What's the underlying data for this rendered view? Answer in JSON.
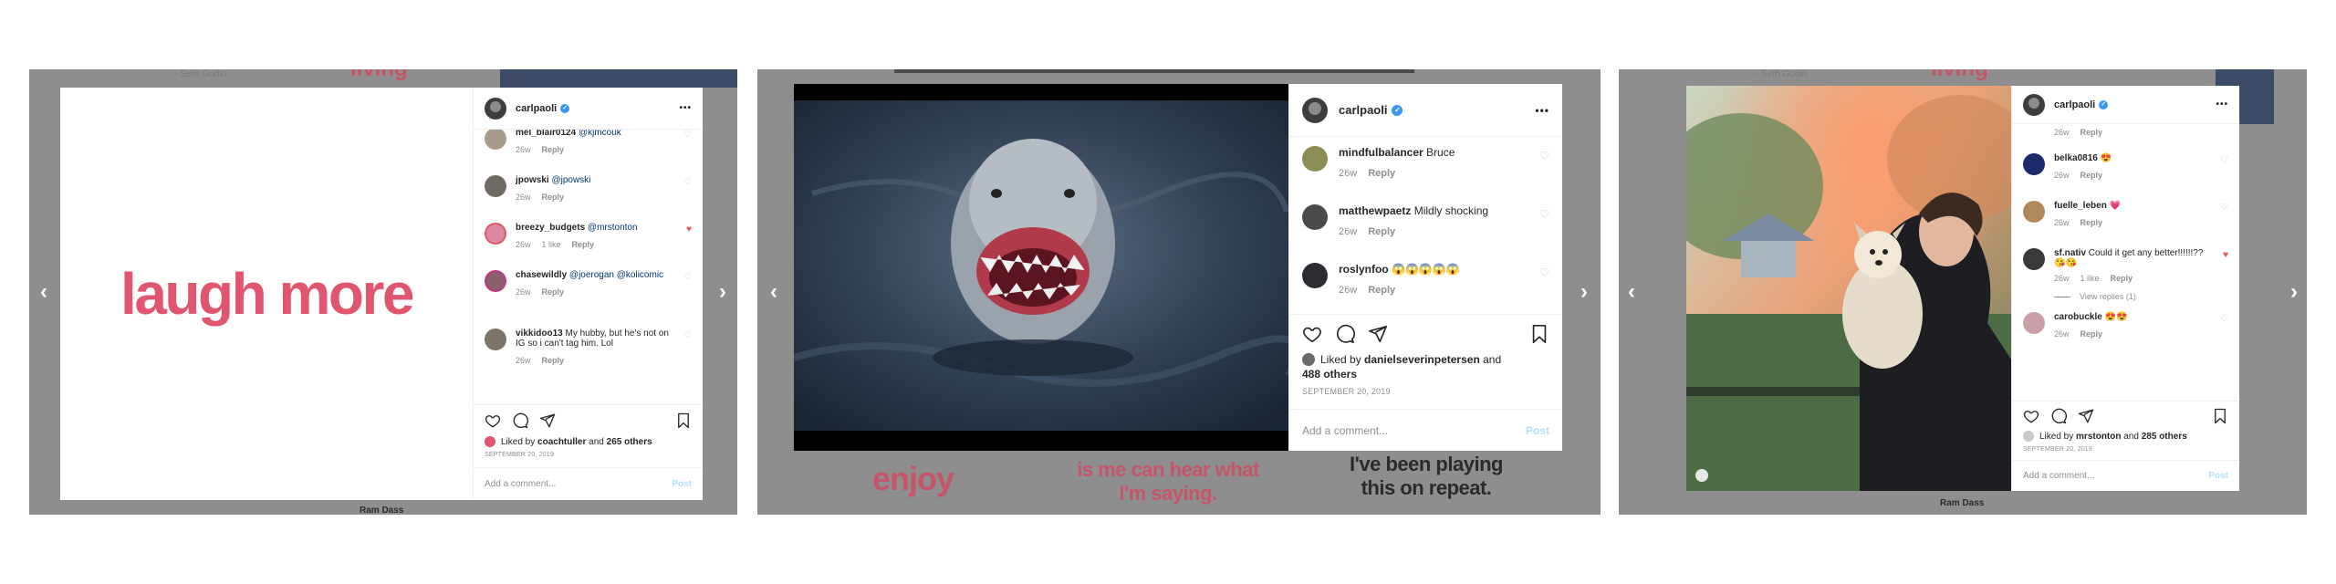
{
  "window": {
    "accent": "#3897f0",
    "like_color": "#ed4956",
    "brand_red": "#e0566f"
  },
  "frame1": {
    "bg": {
      "quote_top": "- Seth Godin",
      "word_top": "living",
      "footer": "Ram Dass"
    },
    "post_text": "laugh more",
    "user": {
      "name": "carlpaoli",
      "verified": "✓"
    },
    "comments": [
      {
        "user": "mel_blair0124",
        "text": "@kjmcouk",
        "time": "26w",
        "reply": "Reply",
        "liked": false
      },
      {
        "user": "jpowski",
        "text": "@jpowski",
        "time": "26w",
        "reply": "Reply",
        "liked": false
      },
      {
        "user": "breezy_budgets",
        "text": "@mrstonton",
        "time": "26w",
        "likes": "1 like",
        "reply": "Reply",
        "liked": true
      },
      {
        "user": "chasewildly",
        "text": "@joerogan @kolicomic",
        "time": "26w",
        "reply": "Reply",
        "liked": false
      },
      {
        "user": "vikkidoo13",
        "text": "My hubby, but he's not on IG so i can't tag him. Lol",
        "time": "26w",
        "reply": "Reply",
        "liked": false
      }
    ],
    "liked_by": "Liked by",
    "liked_user": "coachtuller",
    "and": "and",
    "others": "265 others",
    "date": "September 20, 2019",
    "add_comment_placeholder": "Add a comment...",
    "post": "Post"
  },
  "frame2": {
    "bg": {
      "word1": "enjoy",
      "word2": "is me can hear what I'm saying.",
      "word3": "I've been playing this on repeat."
    },
    "user": {
      "name": "carlpaoli",
      "verified": "✓"
    },
    "comments": [
      {
        "user": "mindfulbalancer",
        "text": "Bruce",
        "time": "26w",
        "reply": "Reply"
      },
      {
        "user": "matthewpaetz",
        "text": "Mildly shocking",
        "time": "26w",
        "reply": "Reply"
      },
      {
        "user": "roslynfoo",
        "text": "😱😱😱😱😱",
        "time": "26w",
        "reply": "Reply"
      }
    ],
    "liked_by": "Liked by",
    "liked_user": "danielseverinpetersen",
    "and": "and",
    "others": "488 others",
    "date": "September 20, 2019",
    "add_comment_placeholder": "Add a comment...",
    "post": "Post"
  },
  "frame3": {
    "bg": {
      "quote_top": "- Seth Godin",
      "word_top": "living",
      "footer": "Ram Dass"
    },
    "user": {
      "name": "carlpaoli",
      "verified": "✓"
    },
    "first_time": "26w",
    "first_reply": "Reply",
    "comments": [
      {
        "user": "belka0816",
        "text": "😍",
        "time": "26w",
        "reply": "Reply",
        "liked": false
      },
      {
        "user": "fuelle_leben",
        "text": "💗",
        "time": "26w",
        "reply": "Reply",
        "liked": false
      },
      {
        "user": "sf.nativ",
        "text": "Could it get any better!!!!!!??😘😘",
        "time": "26w",
        "likes": "1 like",
        "reply": "Reply",
        "liked": true
      },
      {
        "user": "carobuckle",
        "text": "😍😍",
        "time": "26w",
        "reply": "Reply",
        "liked": false
      }
    ],
    "view_replies": "View replies (1)",
    "liked_by": "Liked by",
    "liked_user": "mrstonton",
    "and": "and",
    "others": "285 others",
    "date": "September 20, 2019",
    "add_comment_placeholder": "Add a comment...",
    "post": "Post"
  },
  "icons": {
    "left": "‹",
    "right": "›",
    "heart": "♡",
    "heart_full": "♥",
    "more": "•••"
  }
}
